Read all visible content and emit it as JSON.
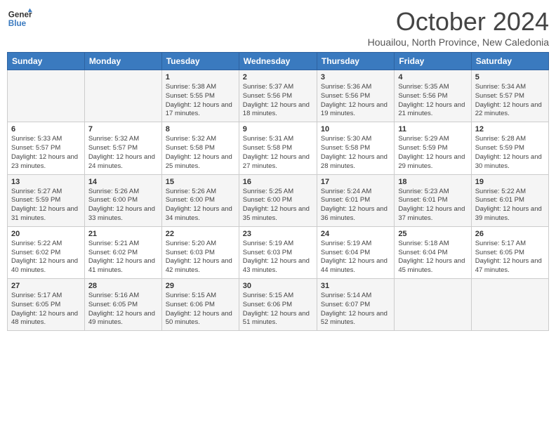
{
  "logo": {
    "line1": "General",
    "line2": "Blue"
  },
  "title": "October 2024",
  "subtitle": "Houailou, North Province, New Caledonia",
  "days_header": [
    "Sunday",
    "Monday",
    "Tuesday",
    "Wednesday",
    "Thursday",
    "Friday",
    "Saturday"
  ],
  "weeks": [
    [
      {
        "num": "",
        "info": ""
      },
      {
        "num": "",
        "info": ""
      },
      {
        "num": "1",
        "info": "Sunrise: 5:38 AM\nSunset: 5:55 PM\nDaylight: 12 hours and 17 minutes."
      },
      {
        "num": "2",
        "info": "Sunrise: 5:37 AM\nSunset: 5:56 PM\nDaylight: 12 hours and 18 minutes."
      },
      {
        "num": "3",
        "info": "Sunrise: 5:36 AM\nSunset: 5:56 PM\nDaylight: 12 hours and 19 minutes."
      },
      {
        "num": "4",
        "info": "Sunrise: 5:35 AM\nSunset: 5:56 PM\nDaylight: 12 hours and 21 minutes."
      },
      {
        "num": "5",
        "info": "Sunrise: 5:34 AM\nSunset: 5:57 PM\nDaylight: 12 hours and 22 minutes."
      }
    ],
    [
      {
        "num": "6",
        "info": "Sunrise: 5:33 AM\nSunset: 5:57 PM\nDaylight: 12 hours and 23 minutes."
      },
      {
        "num": "7",
        "info": "Sunrise: 5:32 AM\nSunset: 5:57 PM\nDaylight: 12 hours and 24 minutes."
      },
      {
        "num": "8",
        "info": "Sunrise: 5:32 AM\nSunset: 5:58 PM\nDaylight: 12 hours and 25 minutes."
      },
      {
        "num": "9",
        "info": "Sunrise: 5:31 AM\nSunset: 5:58 PM\nDaylight: 12 hours and 27 minutes."
      },
      {
        "num": "10",
        "info": "Sunrise: 5:30 AM\nSunset: 5:58 PM\nDaylight: 12 hours and 28 minutes."
      },
      {
        "num": "11",
        "info": "Sunrise: 5:29 AM\nSunset: 5:59 PM\nDaylight: 12 hours and 29 minutes."
      },
      {
        "num": "12",
        "info": "Sunrise: 5:28 AM\nSunset: 5:59 PM\nDaylight: 12 hours and 30 minutes."
      }
    ],
    [
      {
        "num": "13",
        "info": "Sunrise: 5:27 AM\nSunset: 5:59 PM\nDaylight: 12 hours and 31 minutes."
      },
      {
        "num": "14",
        "info": "Sunrise: 5:26 AM\nSunset: 6:00 PM\nDaylight: 12 hours and 33 minutes."
      },
      {
        "num": "15",
        "info": "Sunrise: 5:26 AM\nSunset: 6:00 PM\nDaylight: 12 hours and 34 minutes."
      },
      {
        "num": "16",
        "info": "Sunrise: 5:25 AM\nSunset: 6:00 PM\nDaylight: 12 hours and 35 minutes."
      },
      {
        "num": "17",
        "info": "Sunrise: 5:24 AM\nSunset: 6:01 PM\nDaylight: 12 hours and 36 minutes."
      },
      {
        "num": "18",
        "info": "Sunrise: 5:23 AM\nSunset: 6:01 PM\nDaylight: 12 hours and 37 minutes."
      },
      {
        "num": "19",
        "info": "Sunrise: 5:22 AM\nSunset: 6:01 PM\nDaylight: 12 hours and 39 minutes."
      }
    ],
    [
      {
        "num": "20",
        "info": "Sunrise: 5:22 AM\nSunset: 6:02 PM\nDaylight: 12 hours and 40 minutes."
      },
      {
        "num": "21",
        "info": "Sunrise: 5:21 AM\nSunset: 6:02 PM\nDaylight: 12 hours and 41 minutes."
      },
      {
        "num": "22",
        "info": "Sunrise: 5:20 AM\nSunset: 6:03 PM\nDaylight: 12 hours and 42 minutes."
      },
      {
        "num": "23",
        "info": "Sunrise: 5:19 AM\nSunset: 6:03 PM\nDaylight: 12 hours and 43 minutes."
      },
      {
        "num": "24",
        "info": "Sunrise: 5:19 AM\nSunset: 6:04 PM\nDaylight: 12 hours and 44 minutes."
      },
      {
        "num": "25",
        "info": "Sunrise: 5:18 AM\nSunset: 6:04 PM\nDaylight: 12 hours and 45 minutes."
      },
      {
        "num": "26",
        "info": "Sunrise: 5:17 AM\nSunset: 6:05 PM\nDaylight: 12 hours and 47 minutes."
      }
    ],
    [
      {
        "num": "27",
        "info": "Sunrise: 5:17 AM\nSunset: 6:05 PM\nDaylight: 12 hours and 48 minutes."
      },
      {
        "num": "28",
        "info": "Sunrise: 5:16 AM\nSunset: 6:05 PM\nDaylight: 12 hours and 49 minutes."
      },
      {
        "num": "29",
        "info": "Sunrise: 5:15 AM\nSunset: 6:06 PM\nDaylight: 12 hours and 50 minutes."
      },
      {
        "num": "30",
        "info": "Sunrise: 5:15 AM\nSunset: 6:06 PM\nDaylight: 12 hours and 51 minutes."
      },
      {
        "num": "31",
        "info": "Sunrise: 5:14 AM\nSunset: 6:07 PM\nDaylight: 12 hours and 52 minutes."
      },
      {
        "num": "",
        "info": ""
      },
      {
        "num": "",
        "info": ""
      }
    ]
  ]
}
